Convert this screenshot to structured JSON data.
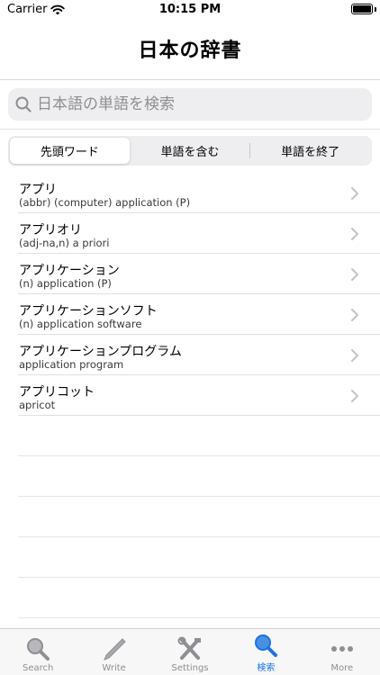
{
  "status": {
    "carrier": "Carrier",
    "time": "10:15 PM"
  },
  "nav": {
    "title": "日本の辞書"
  },
  "search": {
    "placeholder": "日本語の単語を検索",
    "value": ""
  },
  "segments": [
    {
      "label": "先頭ワード",
      "active": true
    },
    {
      "label": "単語を含む",
      "active": false
    },
    {
      "label": "単語を終了",
      "active": false
    }
  ],
  "results": [
    {
      "title": "アプリ",
      "sub": "(abbr) (computer) application (P)"
    },
    {
      "title": "アプリオリ",
      "sub": "(adj-na,n) a priori"
    },
    {
      "title": "アプリケーション",
      "sub": "(n) application (P)"
    },
    {
      "title": "アプリケーションソフト",
      "sub": "(n) application software"
    },
    {
      "title": "アプリケーションプログラム",
      "sub": "application program"
    },
    {
      "title": "アプリコット",
      "sub": "apricot"
    }
  ],
  "tabs": [
    {
      "label": "Search",
      "icon": "magnifier-icon",
      "active": false
    },
    {
      "label": "Write",
      "icon": "pencil-icon",
      "active": false
    },
    {
      "label": "Settings",
      "icon": "tools-icon",
      "active": false
    },
    {
      "label": "検索",
      "icon": "magnifier-icon",
      "active": true
    },
    {
      "label": "More",
      "icon": "more-dots-icon",
      "active": false
    }
  ],
  "colors": {
    "accent": "#1a73e8",
    "inactive": "#8e8e93",
    "searchFill": "#eeeef0"
  }
}
